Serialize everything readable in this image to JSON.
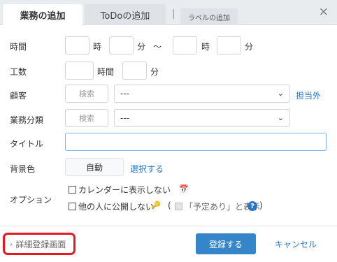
{
  "header": {
    "tabs": [
      "業務の追加",
      "ToDoの追加",
      "ラベルの追加"
    ],
    "separator": "|",
    "close_glyph": "×"
  },
  "form": {
    "time": {
      "label": "時間",
      "hour_unit": "時",
      "minute_unit": "分",
      "tilde": "～"
    },
    "effort": {
      "label": "工数",
      "hour_unit": "時間",
      "minute_unit": "分"
    },
    "customer": {
      "label": "顧客",
      "search_placeholder": "検索",
      "select_value": "---",
      "link": "担当外"
    },
    "category": {
      "label": "業務分類",
      "search_placeholder": "検索",
      "select_value": "---"
    },
    "title": {
      "label": "タイトル",
      "value": ""
    },
    "bgcolor": {
      "label": "背景色",
      "button": "自動",
      "link": "選択する"
    },
    "options": {
      "label": "オプション",
      "opt1": "カレンダーに表示しない",
      "opt2": "他の人に公開しない",
      "paren_open": "(",
      "paren_close": ")",
      "sub": "「予定あり」と表示",
      "help": "?"
    }
  },
  "footer": {
    "detail": "詳細登録画面",
    "detail_arrow": "›",
    "register": "登録する",
    "cancel": "キャンセル"
  },
  "colors": {
    "accent": "#3585c9",
    "link": "#2a76c6",
    "highlight": "#e5191f"
  },
  "icons": [
    "close-icon",
    "chevron-down-icon",
    "calendar-icon",
    "key-icon",
    "help-icon",
    "chevron-right-icon"
  ]
}
